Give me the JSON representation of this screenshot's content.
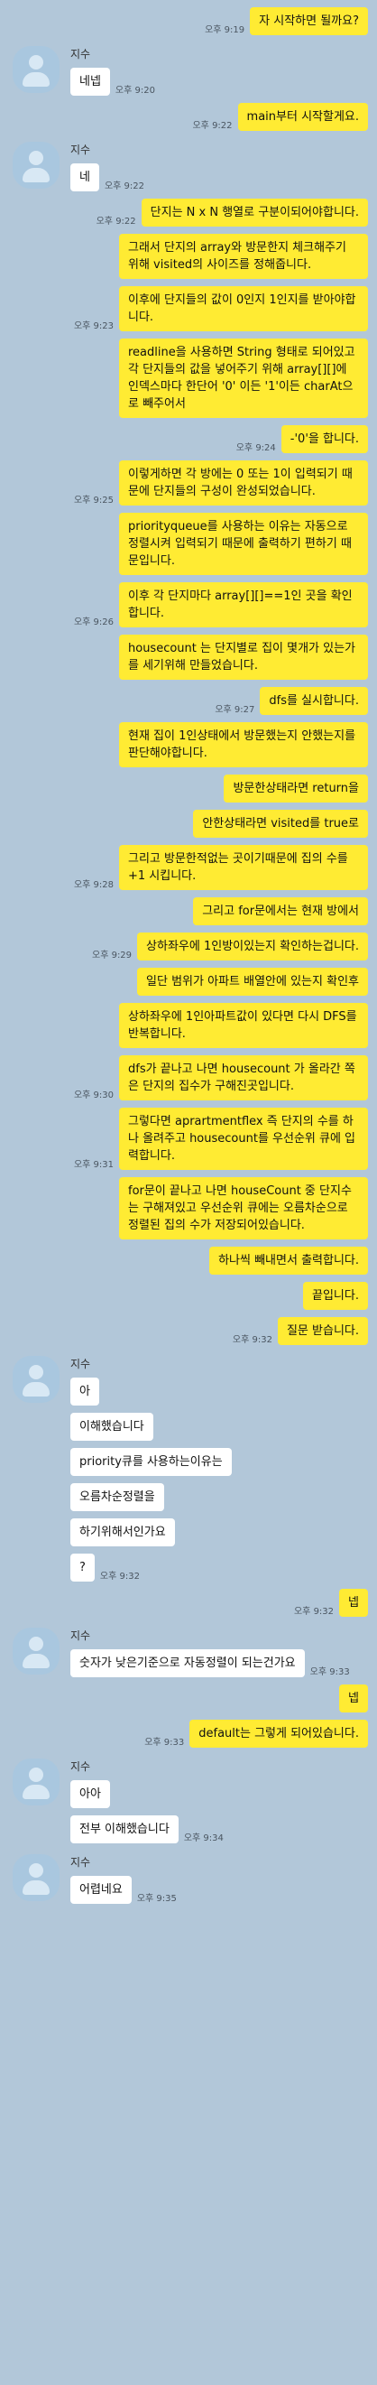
{
  "messages": [
    {
      "side": "me",
      "text": "자 시작하면 될까요?",
      "time": "오후 9:19"
    },
    {
      "side": "other",
      "sender": "지수",
      "text": "네넵",
      "time": "오후 9:20"
    },
    {
      "side": "me",
      "text": "main부터 시작할게요.",
      "time": "오후 9:22"
    },
    {
      "side": "other",
      "sender": "지수",
      "text": "네",
      "time": "오후 9:22"
    },
    {
      "side": "me",
      "text": "단지는 N x N 행열로 구분이되어야합니다.",
      "time": "오후 9:22"
    },
    {
      "side": "me",
      "text": "그래서 단지의 array와 방문한지 체크해주기 위해 visited의 사이즈를 정해줍니다.",
      "time": ""
    },
    {
      "side": "me",
      "text": "이후에 단지들의 값이 0인지 1인지를 받아야합니다.",
      "time": "오후 9:23"
    },
    {
      "side": "me",
      "text": "readline을 사용하면 String 형태로 되어있고 각 단지들의 값을 넣어주기 위해 array[][]에 인덱스마다 한단어 '0' 이든 '1'이든 charAt으로 빼주어서",
      "time": ""
    },
    {
      "side": "me",
      "text": "-'0'을 합니다.",
      "time": "오후 9:24"
    },
    {
      "side": "me",
      "text": "이렇게하면 각 방에는 0 또는 1이 입력되기 때문에 단지들의 구성이 완성되었습니다.",
      "time": "오후 9:25"
    },
    {
      "side": "me",
      "text": "priorityqueue를 사용하는 이유는 자동으로 정렬시켜 입력되기 때문에 출력하기 편하기 때문입니다.",
      "time": ""
    },
    {
      "side": "me",
      "text": "이후 각 단지마다 array[][]==1인 곳을 확인합니다.",
      "time": "오후 9:26"
    },
    {
      "side": "me",
      "text": "housecount 는 단지별로 집이 몇개가 있는가를 세기위해 만들었습니다.",
      "time": ""
    },
    {
      "side": "me",
      "text": "dfs를 실시합니다.",
      "time": "오후 9:27"
    },
    {
      "side": "me",
      "text": "현재 집이 1인상태에서 방문했는지 안했는지를 판단해야합니다.",
      "time": ""
    },
    {
      "side": "me",
      "text": "방문한상태라면 return을",
      "time": ""
    },
    {
      "side": "me",
      "text": "안한상태라면 visited를 true로",
      "time": ""
    },
    {
      "side": "me",
      "text": "그리고 방문한적없는 곳이기때문에 집의 수를 +1 시킵니다.",
      "time": "오후 9:28"
    },
    {
      "side": "me",
      "text": "그리고 for문에서는 현재 방에서",
      "time": ""
    },
    {
      "side": "me",
      "text": "상하좌우에 1인방이있는지 확인하는겁니다.",
      "time": "오후 9:29"
    },
    {
      "side": "me",
      "text": "일단 범위가 아파트 배열안에 있는지 확인후",
      "time": ""
    },
    {
      "side": "me",
      "text": "상하좌우에 1인아파트값이 있다면 다시 DFS를 반복합니다.",
      "time": ""
    },
    {
      "side": "me",
      "text": "dfs가 끝나고 나면 housecount 가 올라간 쪽은 단지의 집수가 구해진곳입니다.",
      "time": "오후 9:30"
    },
    {
      "side": "me",
      "text": "그렇다면 aprartmentflex 즉 단지의 수를 하나 올려주고 housecount를 우선순위 큐에 입력합니다.",
      "time": "오후 9:31"
    },
    {
      "side": "me",
      "text": "for문이 끝나고 나면 houseCount 중 단지수는 구해져있고 우선순위 큐에는 오름차순으로 정렬된 집의 수가 저장되어있습니다.",
      "time": ""
    },
    {
      "side": "me",
      "text": "하나씩 빼내면서 출력합니다.",
      "time": ""
    },
    {
      "side": "me",
      "text": "끝입니다.",
      "time": ""
    },
    {
      "side": "me",
      "text": "질문 받습니다.",
      "time": "오후 9:32"
    },
    {
      "side": "other",
      "sender": "지수",
      "text": "아",
      "time": ""
    },
    {
      "side": "other",
      "text": "이해했습니다",
      "time": ""
    },
    {
      "side": "other",
      "text": "priority큐를 사용하는이유는",
      "time": ""
    },
    {
      "side": "other",
      "text": "오름차순정렬을",
      "time": ""
    },
    {
      "side": "other",
      "text": "하기위해서인가요",
      "time": ""
    },
    {
      "side": "other",
      "text": "?",
      "time": "오후 9:32"
    },
    {
      "side": "me",
      "text": "넵",
      "time": "오후 9:32"
    },
    {
      "side": "other",
      "sender": "지수",
      "text": "숫자가 낮은기준으로 자동정렬이 되는건가요",
      "time": "오후 9:33"
    },
    {
      "side": "me",
      "text": "넵",
      "time": ""
    },
    {
      "side": "me",
      "text": "default는 그렇게 되어있습니다.",
      "time": "오후 9:33"
    },
    {
      "side": "other",
      "sender": "지수",
      "text": "아아",
      "time": ""
    },
    {
      "side": "other",
      "text": "전부 이해했습니다",
      "time": "오후 9:34"
    },
    {
      "side": "other",
      "sender": "지수",
      "text": "어렵네요",
      "time": "오후 9:35"
    }
  ]
}
